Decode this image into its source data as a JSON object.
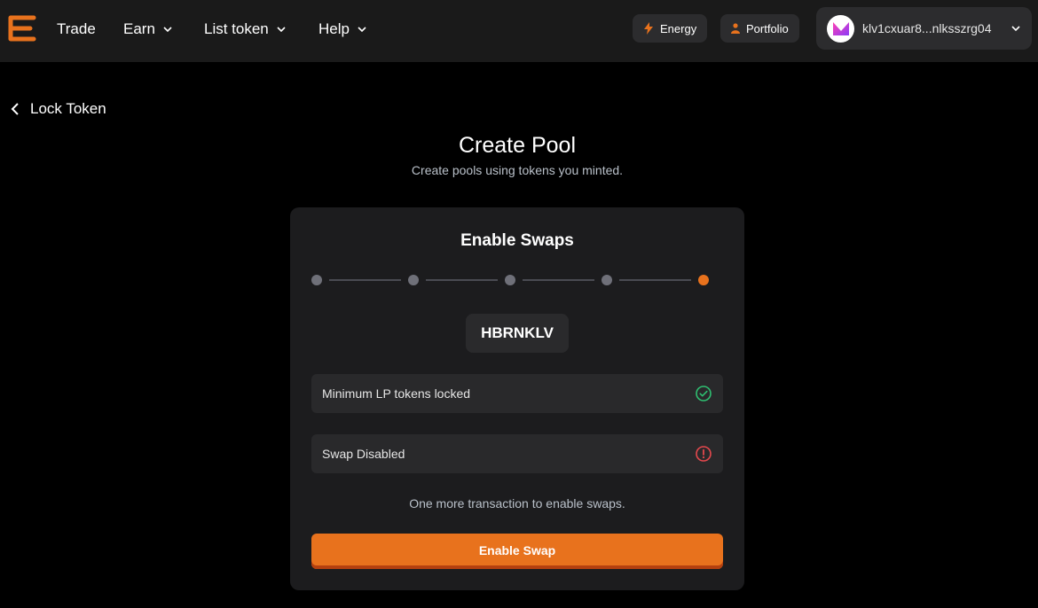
{
  "nav": {
    "items": [
      {
        "label": "Trade",
        "has_dropdown": false
      },
      {
        "label": "Earn",
        "has_dropdown": true
      },
      {
        "label": "List token",
        "has_dropdown": true
      },
      {
        "label": "Help",
        "has_dropdown": true
      }
    ],
    "energy_label": "Energy",
    "portfolio_label": "Portfolio",
    "wallet_address": "klv1cxuar8...nlksszrg04",
    "accent_color": "#e8721d"
  },
  "back": {
    "label": "Lock Token"
  },
  "header": {
    "title": "Create Pool",
    "subtitle": "Create pools using tokens you minted."
  },
  "card": {
    "title": "Enable Swaps",
    "steps_total": 5,
    "active_step": 5,
    "token": "HBRNKLV",
    "statuses": [
      {
        "label": "Minimum LP tokens locked",
        "state": "success",
        "icon": "check-circle-icon",
        "color": "#2fbf71"
      },
      {
        "label": "Swap Disabled",
        "state": "error",
        "icon": "alert-circle-icon",
        "color": "#e5484d"
      }
    ],
    "info": "One more transaction to enable swaps.",
    "button_label": "Enable Swap"
  }
}
